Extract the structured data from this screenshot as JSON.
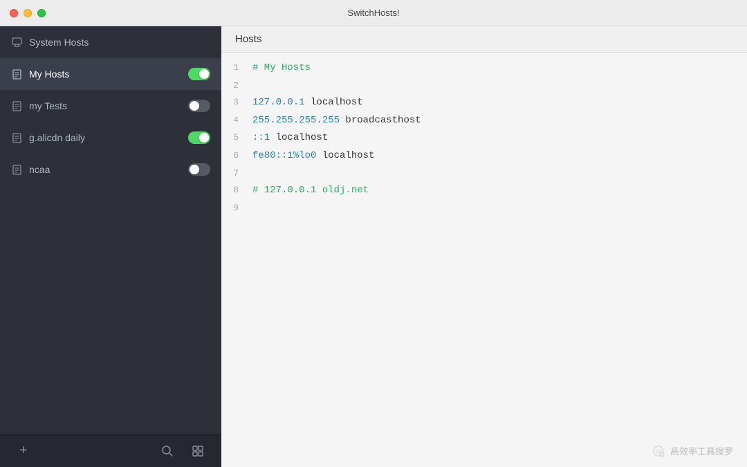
{
  "titlebar": {
    "title": "SwitchHosts!",
    "controls": {
      "red": "close",
      "yellow": "minimize",
      "green": "maximize"
    }
  },
  "sidebar": {
    "items": [
      {
        "id": "system-hosts",
        "label": "System Hosts",
        "icon": "monitor-icon",
        "toggle": null,
        "active": false
      },
      {
        "id": "my-hosts",
        "label": "My Hosts",
        "icon": "file-icon",
        "toggle": "on",
        "active": true
      },
      {
        "id": "my-tests",
        "label": "my Tests",
        "icon": "file-icon",
        "toggle": "off",
        "active": false
      },
      {
        "id": "g-alicdn-daily",
        "label": "g.alicdn daily",
        "icon": "file-icon",
        "toggle": "on",
        "active": false
      },
      {
        "id": "ncaa",
        "label": "ncaa",
        "icon": "file-icon",
        "toggle": "off",
        "active": false
      }
    ],
    "toolbar": {
      "add_label": "+",
      "search_label": "⌕",
      "settings_label": "⊞"
    }
  },
  "editor": {
    "title": "Hosts",
    "lines": [
      {
        "num": "1",
        "type": "comment",
        "content": "# My Hosts"
      },
      {
        "num": "2",
        "type": "empty",
        "content": ""
      },
      {
        "num": "3",
        "type": "ip-host",
        "ip": "127.0.0.1",
        "host": "localhost"
      },
      {
        "num": "4",
        "type": "ip-host",
        "ip": "255.255.255.255",
        "host": "broadcasthost"
      },
      {
        "num": "5",
        "type": "ip-host",
        "ip": "::1",
        "host": "localhost"
      },
      {
        "num": "6",
        "type": "ip-host",
        "ip": "fe80::1%lo0",
        "host": "localhost"
      },
      {
        "num": "7",
        "type": "empty",
        "content": ""
      },
      {
        "num": "8",
        "type": "comment",
        "content": "# 127.0.0.1 oldj.net"
      },
      {
        "num": "9",
        "type": "empty",
        "content": ""
      }
    ]
  },
  "watermark": {
    "text": "高效率工具搜罗"
  }
}
